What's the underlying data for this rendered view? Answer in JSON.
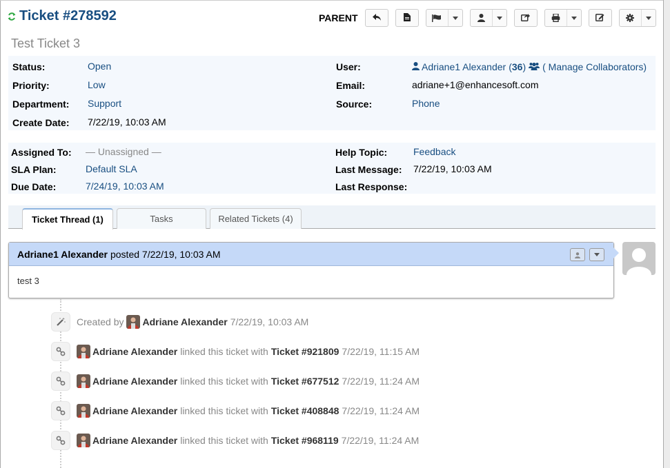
{
  "header": {
    "ticket_title": "Ticket #278592",
    "subject": "Test Ticket 3",
    "parent_label": "PARENT",
    "actions": [
      {
        "name": "reply",
        "icon": "reply-icon"
      },
      {
        "name": "view-pdf",
        "icon": "file-icon"
      },
      {
        "name": "status",
        "icon": "flag-icon",
        "dropdown": true
      },
      {
        "name": "assign",
        "icon": "user-icon",
        "dropdown": true
      },
      {
        "name": "transfer",
        "icon": "share-icon"
      },
      {
        "name": "print",
        "icon": "print-icon",
        "dropdown": true
      },
      {
        "name": "edit",
        "icon": "edit-icon"
      },
      {
        "name": "more",
        "icon": "gear-icon",
        "dropdown": true
      }
    ]
  },
  "info_top": {
    "left": [
      {
        "label": "Status:",
        "value": "Open",
        "link": true
      },
      {
        "label": "Priority:",
        "value": "Low",
        "link": true
      },
      {
        "label": "Department:",
        "value": "Support",
        "link": true
      },
      {
        "label": "Create Date:",
        "value": "7/22/19, 10:03 AM",
        "link": false
      }
    ],
    "right": {
      "user_label": "User:",
      "user_name": "Adriane1 Alexander",
      "user_count_open": "(",
      "user_count": "36",
      "user_count_close": ")",
      "manage_collaborators": "( Manage Collaborators)",
      "email_label": "Email:",
      "email": "adriane+1@enhancesoft.com",
      "source_label": "Source:",
      "source": "Phone"
    }
  },
  "info_bottom": {
    "left": [
      {
        "label": "Assigned To:",
        "value": "— Unassigned —"
      },
      {
        "label": "SLA Plan:",
        "value": "Default SLA"
      },
      {
        "label": "Due Date:",
        "value": "7/24/19, 10:03 AM"
      }
    ],
    "right": [
      {
        "label": "Help Topic:",
        "value": "Feedback"
      },
      {
        "label": "Last Message:",
        "value": "7/22/19, 10:03 AM"
      },
      {
        "label": "Last Response:",
        "value": ""
      }
    ]
  },
  "tabs": [
    {
      "label": "Ticket Thread (1)",
      "active": true
    },
    {
      "label": "Tasks",
      "active": false
    },
    {
      "label": "Related Tickets (4)",
      "active": false
    }
  ],
  "thread": {
    "author": "Adriane1 Alexander",
    "posted_text": "posted 7/22/19, 10:03 AM",
    "body": "test 3"
  },
  "events": [
    {
      "type": "created",
      "icon": "magic-wand-icon",
      "prefix": "Created by",
      "user": "Adriane Alexander",
      "time": "7/22/19, 10:03 AM"
    },
    {
      "type": "linked",
      "icon": "link-icon",
      "user": "Adriane Alexander",
      "action": "linked this ticket with",
      "ticket": "Ticket #921809",
      "time": "7/22/19, 11:15 AM"
    },
    {
      "type": "linked",
      "icon": "link-icon",
      "user": "Adriane Alexander",
      "action": "linked this ticket with",
      "ticket": "Ticket #677512",
      "time": "7/22/19, 11:24 AM"
    },
    {
      "type": "linked",
      "icon": "link-icon",
      "user": "Adriane Alexander",
      "action": "linked this ticket with",
      "ticket": "Ticket #408848",
      "time": "7/22/19, 11:24 AM"
    },
    {
      "type": "linked",
      "icon": "link-icon",
      "user": "Adriane Alexander",
      "action": "linked this ticket with",
      "ticket": "Ticket #968119",
      "time": "7/22/19, 11:24 AM"
    }
  ],
  "colors": {
    "title": "#184E81",
    "link": "#184E81",
    "refresh": "#2EA843",
    "info_bg": "#F4F8FD",
    "thread_header_bg": "#C5D9F8"
  }
}
